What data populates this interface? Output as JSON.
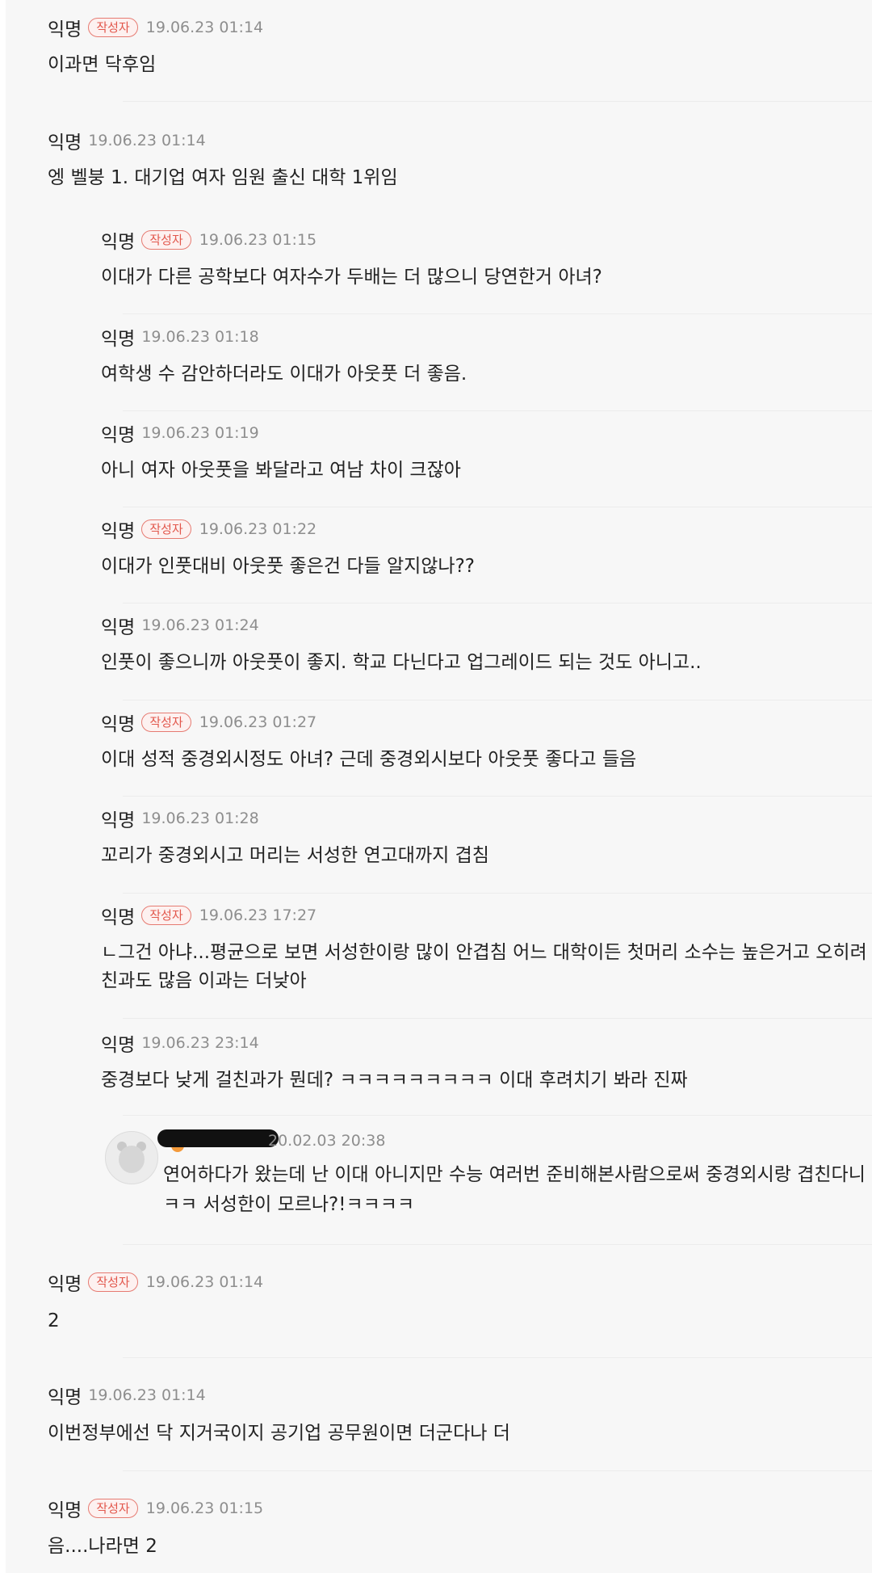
{
  "comments": [
    {
      "author": "익명",
      "badge": "작성자",
      "time": "19.06.23 01:14",
      "body": [
        "이과면 닥후임"
      ]
    },
    {
      "author": "익명",
      "time": "19.06.23 01:14",
      "body": [
        "엥 벨붕 1. 대기업 여자 임원 출신 대학 1위임"
      ]
    },
    {
      "author": "익명",
      "badge": "작성자",
      "time": "19.06.23 01:15",
      "body": [
        "이대가 다른 공학보다 여자수가 두배는 더 많으니 당연한거 아녀?"
      ]
    },
    {
      "author": "익명",
      "time": "19.06.23 01:18",
      "body": [
        "여학생 수 감안하더라도 이대가 아웃풋 더 좋음."
      ]
    },
    {
      "author": "익명",
      "time": "19.06.23 01:19",
      "body": [
        "아니 여자 아웃풋을 봐달라고 여남 차이 크잖아"
      ]
    },
    {
      "author": "익명",
      "badge": "작성자",
      "time": "19.06.23 01:22",
      "body": [
        "이대가 인풋대비 아웃풋 좋은건 다들 알지않나??"
      ]
    },
    {
      "author": "익명",
      "time": "19.06.23 01:24",
      "body": [
        "인풋이 좋으니까 아웃풋이 좋지. 학교 다닌다고 업그레이드 되는 것도 아니고.."
      ]
    },
    {
      "author": "익명",
      "badge": "작성자",
      "time": "19.06.23 01:27",
      "body": [
        "이대 성적 중경외시정도 아녀? 근데 중경외시보다 아웃풋 좋다고 들음"
      ]
    },
    {
      "author": "익명",
      "time": "19.06.23 01:28",
      "body": [
        "꼬리가 중경외시고 머리는 서성한 연고대까지 겹침"
      ]
    },
    {
      "author": "익명",
      "badge": "작성자",
      "time": "19.06.23 17:27",
      "body": [
        "ㄴ그건 아냐...평균으로 보면 서성한이랑 많이 안겹침 어느 대학이든 첫머리 소수는 높은거고 오히려",
        "친과도 많음 이과는 더낮아"
      ]
    },
    {
      "author": "익명",
      "time": "19.06.23 23:14",
      "body": [
        "중경보다 낮게 걸친과가 뭔데? ㅋㅋㅋㅋㅋㅋㅋㅋㅋ 이대 후려치기 봐라 진짜"
      ]
    },
    {
      "time": "20.02.03 20:38",
      "body": [
        "연어하다가 왔는데 난 이대 아니지만 수능 여러번 준비해본사람으로써 중경외시랑 겹친다니",
        "ㅋㅋ 서성한이 모르나?!ㅋㅋㅋㅋ"
      ]
    },
    {
      "author": "익명",
      "badge": "작성자",
      "time": "19.06.23 01:14",
      "body": [
        "2"
      ]
    },
    {
      "author": "익명",
      "time": "19.06.23 01:14",
      "body": [
        "이번정부에선 닥 지거국이지 공기업 공무원이면 더군다나 더"
      ]
    },
    {
      "author": "익명",
      "badge": "작성자",
      "time": "19.06.23 01:15",
      "body": [
        "음....나라면 2"
      ]
    }
  ]
}
